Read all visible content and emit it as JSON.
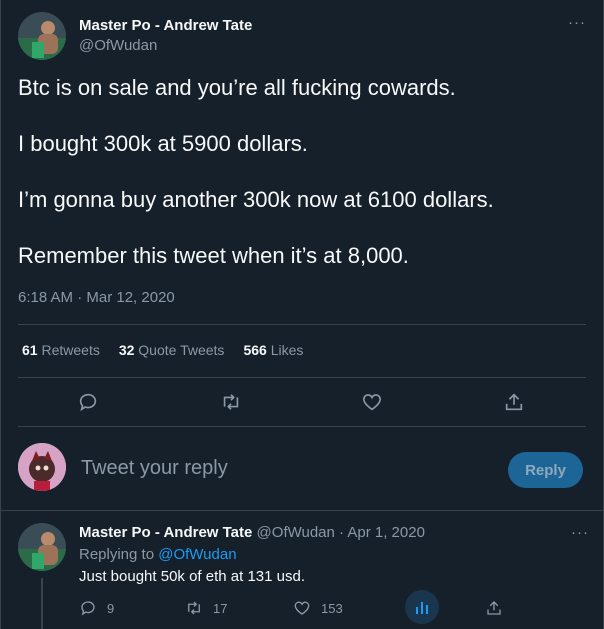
{
  "tweet": {
    "author_name": "Master Po - Andrew Tate",
    "author_handle": "@OfWudan",
    "more_label": "···",
    "lines": [
      "Btc is on sale and you’re all fucking cowards.",
      "I bought 300k at 5900 dollars.",
      "I’m gonna buy another 300k now at 6100 dollars.",
      "Remember this tweet when it’s at 8,000."
    ],
    "timestamp": "6:18 AM · Mar 12, 2020",
    "stats": {
      "retweets_count": "61",
      "retweets_label": "Retweets",
      "quotes_count": "32",
      "quotes_label": "Quote Tweets",
      "likes_count": "566",
      "likes_label": "Likes"
    },
    "actions": [
      "reply-icon",
      "retweet-icon",
      "like-icon",
      "share-icon"
    ]
  },
  "composer": {
    "placeholder": "Tweet your reply",
    "reply_button": "Reply"
  },
  "reply_tweet": {
    "author_name": "Master Po - Andrew Tate",
    "meta": "@OfWudan · Apr 1, 2020",
    "replying_prefix": "Replying to ",
    "replying_handle": "@OfWudan",
    "text": "Just bought 50k of eth at 131 usd.",
    "more_label": "···",
    "reply_count": "9",
    "retweet_count": "17",
    "like_count": "153"
  },
  "colors": {
    "background": "#15202b",
    "text": "#f7f9f9",
    "muted": "#8b98a5",
    "accent": "#1d9bf0",
    "border": "#38444d"
  }
}
